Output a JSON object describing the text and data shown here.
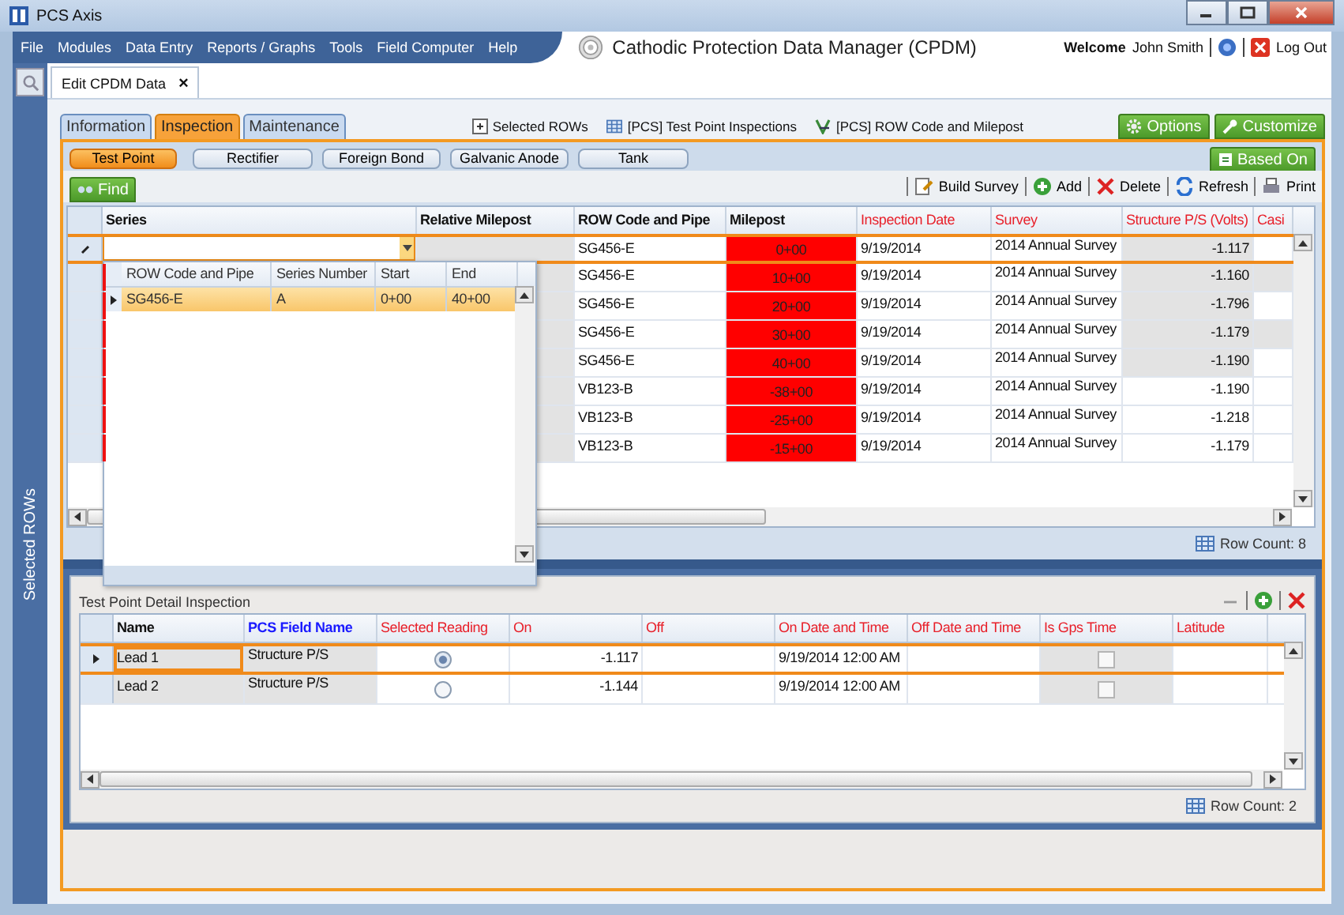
{
  "window": {
    "title": "PCS Axis"
  },
  "menu": [
    "File",
    "Modules",
    "Data Entry",
    "Reports / Graphs",
    "Tools",
    "Field Computer",
    "Help"
  ],
  "app_title": "Cathodic Protection Data Manager (CPDM)",
  "user": {
    "welcome": "Welcome",
    "name": "John Smith",
    "logout": "Log Out"
  },
  "document_tab": {
    "label": "Edit CPDM Data",
    "close": "×"
  },
  "sidebar": {
    "label": "Selected ROWs"
  },
  "section_tabs": [
    {
      "label": "Information",
      "selected": false
    },
    {
      "label": "Inspection",
      "selected": true
    },
    {
      "label": "Maintenance",
      "selected": false
    }
  ],
  "links": [
    {
      "label": "Selected ROWs",
      "kind": "rows"
    },
    {
      "label": "[PCS] Test Point Inspections",
      "kind": "grid"
    },
    {
      "label": "[PCS] ROW Code and Milepost",
      "kind": "route"
    }
  ],
  "header_buttons": [
    {
      "label": "Options",
      "kind": "gear"
    },
    {
      "label": "Customize",
      "kind": "wrench"
    }
  ],
  "sub_tabs": [
    {
      "label": "Test Point",
      "selected": true
    },
    {
      "label": "Rectifier",
      "selected": false
    },
    {
      "label": "Foreign Bond",
      "selected": false
    },
    {
      "label": "Galvanic Anode",
      "selected": false
    },
    {
      "label": "Tank",
      "selected": false
    }
  ],
  "based_on": "Based On",
  "find": "Find",
  "toolbar": [
    {
      "label": "Build Survey",
      "kind": "survey"
    },
    {
      "label": "Add",
      "kind": "add"
    },
    {
      "label": "Delete",
      "kind": "delete"
    },
    {
      "label": "Refresh",
      "kind": "refresh"
    },
    {
      "label": "Print",
      "kind": "print"
    }
  ],
  "grid": {
    "columns": [
      {
        "label": "Series",
        "kind": "plain"
      },
      {
        "label": "Relative Milepost",
        "kind": "plain"
      },
      {
        "label": "ROW Code and Pipe",
        "kind": "plain"
      },
      {
        "label": "Milepost",
        "kind": "plain"
      },
      {
        "label": "Inspection Date",
        "kind": "required"
      },
      {
        "label": "Survey",
        "kind": "required"
      },
      {
        "label": "Structure P/S (Volts)",
        "kind": "required"
      },
      {
        "label": "Casi",
        "kind": "required"
      }
    ],
    "rows": [
      {
        "row_code": "SG456-E",
        "milepost": "0+00",
        "inspection_date": "9/19/2014",
        "survey": "2014 Annual Survey",
        "structure_ps": "-1.117",
        "editing": true,
        "milepost_flagged": true,
        "ps_shaded": true,
        "casing_shaded": false,
        "error_mark": false
      },
      {
        "row_code": "SG456-E",
        "milepost": "10+00",
        "inspection_date": "9/19/2014",
        "survey": "2014 Annual Survey",
        "structure_ps": "-1.160",
        "editing": false,
        "milepost_flagged": true,
        "ps_shaded": true,
        "casing_shaded": true,
        "error_mark": true
      },
      {
        "row_code": "SG456-E",
        "milepost": "20+00",
        "inspection_date": "9/19/2014",
        "survey": "2014 Annual Survey",
        "structure_ps": "-1.796",
        "editing": false,
        "milepost_flagged": true,
        "ps_shaded": true,
        "casing_shaded": false,
        "error_mark": true
      },
      {
        "row_code": "SG456-E",
        "milepost": "30+00",
        "inspection_date": "9/19/2014",
        "survey": "2014 Annual Survey",
        "structure_ps": "-1.179",
        "editing": false,
        "milepost_flagged": true,
        "ps_shaded": true,
        "casing_shaded": true,
        "error_mark": true
      },
      {
        "row_code": "SG456-E",
        "milepost": "40+00",
        "inspection_date": "9/19/2014",
        "survey": "2014 Annual Survey",
        "structure_ps": "-1.190",
        "editing": false,
        "milepost_flagged": true,
        "ps_shaded": true,
        "casing_shaded": false,
        "error_mark": true
      },
      {
        "row_code": "VB123-B",
        "milepost": "-38+00",
        "inspection_date": "9/19/2014",
        "survey": "2014 Annual Survey",
        "structure_ps": "-1.190",
        "editing": false,
        "milepost_flagged": true,
        "ps_shaded": false,
        "casing_shaded": false,
        "error_mark": true
      },
      {
        "row_code": "VB123-B",
        "milepost": "-25+00",
        "inspection_date": "9/19/2014",
        "survey": "2014 Annual Survey",
        "structure_ps": "-1.218",
        "editing": false,
        "milepost_flagged": true,
        "ps_shaded": false,
        "casing_shaded": false,
        "error_mark": true
      },
      {
        "row_code": "VB123-B",
        "milepost": "-15+00",
        "inspection_date": "9/19/2014",
        "survey": "2014 Annual Survey",
        "structure_ps": "-1.179",
        "editing": false,
        "milepost_flagged": true,
        "ps_shaded": false,
        "casing_shaded": false,
        "error_mark": true
      }
    ],
    "row_count": "Row Count: 8"
  },
  "series_dropdown": {
    "columns": [
      "ROW Code and Pipe",
      "Series Number",
      "Start",
      "End"
    ],
    "rows": [
      {
        "row_code": "SG456-E",
        "series_number": "A",
        "start": "0+00",
        "end": "40+00",
        "selected": true
      }
    ]
  },
  "detail": {
    "title": "Test Point Detail Inspection",
    "columns": [
      {
        "label": "Name",
        "kind": "plain"
      },
      {
        "label": "PCS Field Name",
        "kind": "field"
      },
      {
        "label": "Selected Reading",
        "kind": "required"
      },
      {
        "label": "On",
        "kind": "required"
      },
      {
        "label": "Off",
        "kind": "required"
      },
      {
        "label": "On Date and Time",
        "kind": "required"
      },
      {
        "label": "Off Date and Time",
        "kind": "required"
      },
      {
        "label": "Is Gps Time",
        "kind": "required"
      },
      {
        "label": "Latitude",
        "kind": "required"
      }
    ],
    "rows": [
      {
        "name": "Lead 1",
        "field_name": "Structure P/S",
        "selected_reading": true,
        "on": "-1.117",
        "on_date": "9/19/2014 12:00 AM",
        "gps_time": false,
        "selected": true
      },
      {
        "name": "Lead 2",
        "field_name": "Structure P/S",
        "selected_reading": false,
        "on": "-1.144",
        "on_date": "9/19/2014 12:00 AM",
        "gps_time": false,
        "selected": false
      }
    ],
    "row_count": "Row Count: 2"
  }
}
